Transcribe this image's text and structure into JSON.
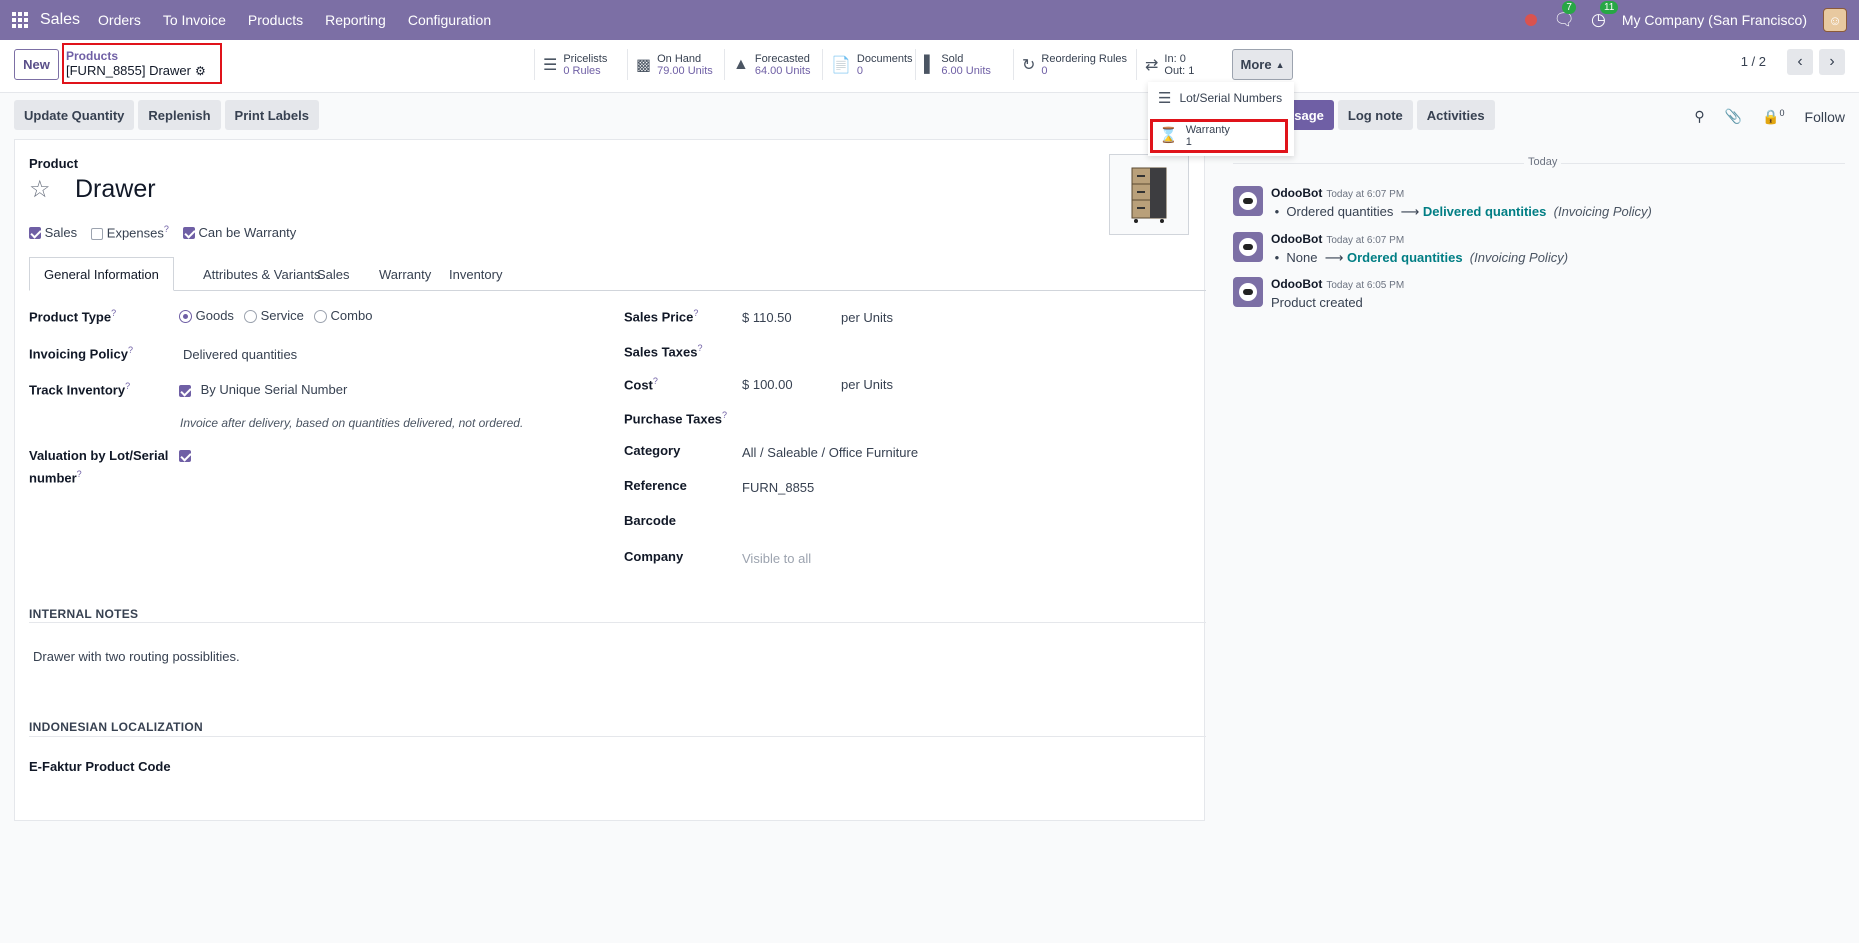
{
  "topbar": {
    "app_name": "Sales",
    "menu": [
      "Orders",
      "To Invoice",
      "Products",
      "Reporting",
      "Configuration"
    ],
    "messages_count": "7",
    "activities_count": "11",
    "company": "My Company (San Francisco)"
  },
  "control": {
    "new_label": "New",
    "breadcrumb_parent": "Products",
    "breadcrumb_current": "[FURN_8855] Drawer",
    "stats": [
      {
        "label": "Pricelists",
        "value": "0 Rules",
        "icon": "list-icon"
      },
      {
        "label": "On Hand",
        "value": "79.00 Units",
        "icon": "cubes-icon"
      },
      {
        "label": "Forecasted",
        "value": "64.00 Units",
        "icon": "area-chart-icon"
      },
      {
        "label": "Documents",
        "value": "0",
        "icon": "file-icon"
      },
      {
        "label": "Sold",
        "value": "6.00 Units",
        "icon": "signal-icon"
      },
      {
        "label": "Reordering Rules",
        "value": "0",
        "icon": "refresh-icon"
      },
      {
        "label": "In: 0",
        "value": "Out: 1",
        "icon": "exchange-icon"
      }
    ],
    "more_label": "More",
    "pager": "1 / 2"
  },
  "more_menu": {
    "items": [
      {
        "label": "Lot/Serial Numbers",
        "value": ""
      },
      {
        "label": "Warranty",
        "value": "1"
      }
    ]
  },
  "actions": [
    "Update Quantity",
    "Replenish",
    "Print Labels"
  ],
  "chatter": {
    "send_label": "ssage",
    "log_note": "Log note",
    "activities": "Activities",
    "followers_count": "0",
    "follow": "Follow",
    "today": "Today",
    "messages": [
      {
        "author": "OdooBot",
        "time": "Today at 6:07 PM",
        "old": "Ordered quantities",
        "new": "Delivered quantities",
        "field": "(Invoicing Policy)"
      },
      {
        "author": "OdooBot",
        "time": "Today at 6:07 PM",
        "old": "None",
        "new": "Ordered quantities",
        "field": "(Invoicing Policy)"
      },
      {
        "author": "OdooBot",
        "time": "Today at 6:05 PM",
        "text": "Product created"
      }
    ]
  },
  "form": {
    "product_label": "Product",
    "name": "Drawer",
    "checks": {
      "sales": "Sales",
      "expenses": "Expenses",
      "warranty": "Can be Warranty"
    },
    "tabs": [
      "General Information",
      "Attributes & Variants",
      "Sales",
      "Warranty",
      "Inventory"
    ],
    "product_type_label": "Product Type",
    "types": [
      "Goods",
      "Service",
      "Combo"
    ],
    "invoicing_policy_label": "Invoicing Policy",
    "invoicing_policy": "Delivered quantities",
    "track_inventory_label": "Track Inventory",
    "track_inventory": "By Unique Serial Number",
    "hint": "Invoice after delivery, based on quantities delivered, not ordered.",
    "valuation_label_1": "Valuation by Lot/Serial",
    "valuation_label_2": "number",
    "sales_price_label": "Sales Price",
    "sales_price": "$ 110.50",
    "per_units": "per  Units",
    "sales_taxes_label": "Sales Taxes",
    "cost_label": "Cost",
    "cost": "$ 100.00",
    "cost_per": "per Units",
    "purchase_taxes_label": "Purchase Taxes",
    "category_label": "Category",
    "category": "All / Saleable / Office Furniture",
    "reference_label": "Reference",
    "reference": "FURN_8855",
    "barcode_label": "Barcode",
    "company_label": "Company",
    "company_placeholder": "Visible to all",
    "internal_notes_title": "INTERNAL NOTES",
    "internal_notes": "Drawer with two routing possiblities.",
    "indonesian_title": "INDONESIAN LOCALIZATION",
    "efaktur_label": "E-Faktur Product Code"
  }
}
